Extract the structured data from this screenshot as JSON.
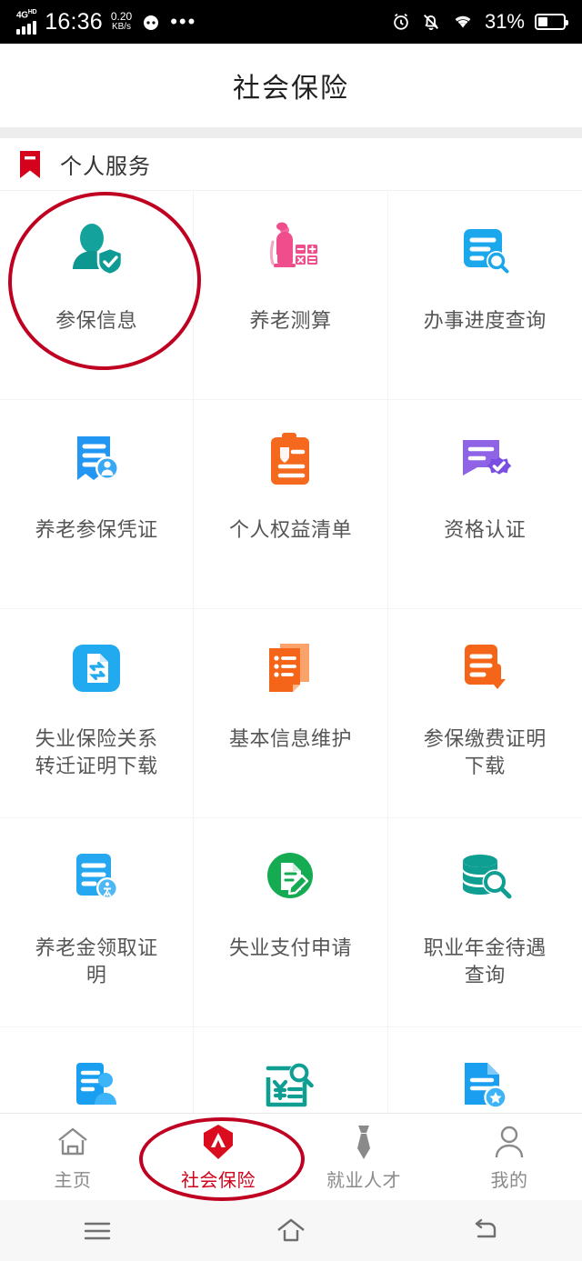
{
  "status_bar": {
    "network_label": "4G",
    "network_sup": "HD",
    "time": "16:36",
    "speed_value": "0.20",
    "speed_unit": "KB/s",
    "more_icon": "ellipsis-icon",
    "face_icon": "emoji-face-icon",
    "alarm_icon": "alarm-clock-icon",
    "mute_icon": "bell-muted-icon",
    "wifi_icon": "wifi-icon",
    "battery_percent": "31%",
    "battery_icon": "battery-icon"
  },
  "header": {
    "title": "社会保险"
  },
  "section": {
    "icon": "bookmark-icon",
    "title": "个人服务",
    "accent": "#d4021d"
  },
  "grid": {
    "items": [
      {
        "label": "参保信息",
        "icon": "person-shield-icon",
        "color": "#12a0a0"
      },
      {
        "label": "养老测算",
        "icon": "elderly-calculator-icon",
        "color": "#ef4d8b"
      },
      {
        "label": "办事进度查询",
        "icon": "document-search-icon",
        "color": "#1aa7ec"
      },
      {
        "label": "养老参保凭证",
        "icon": "certificate-person-icon",
        "color": "#2196f3"
      },
      {
        "label": "个人权益清单",
        "icon": "clipboard-list-icon",
        "color": "#f4691d"
      },
      {
        "label": "资格认证",
        "icon": "document-verified-icon",
        "color": "#8e63e6"
      },
      {
        "label": "失业保险关系转迁证明下载",
        "icon": "transfer-file-icon",
        "color": "#22aaf0"
      },
      {
        "label": "基本信息维护",
        "icon": "document-edit-list-icon",
        "color": "#f4651a"
      },
      {
        "label": "参保缴费证明下载",
        "icon": "document-download-icon",
        "color": "#f4651a"
      },
      {
        "label": "养老金领取证明",
        "icon": "document-pension-icon",
        "color": "#25a8f0"
      },
      {
        "label": "失业支付申请",
        "icon": "circle-document-pen-icon",
        "color": "#14ab52"
      },
      {
        "label": "职业年金待遇查询",
        "icon": "coins-search-icon",
        "color": "#0f9e92"
      },
      {
        "label": "",
        "icon": "id-card-person-icon",
        "color": "#1a9ff0"
      },
      {
        "label": "",
        "icon": "yuan-bill-search-icon",
        "color": "#0f9e92"
      },
      {
        "label": "",
        "icon": "document-star-icon",
        "color": "#1a9ff0"
      }
    ]
  },
  "tabbar": {
    "items": [
      {
        "label": "主页",
        "icon": "home-icon",
        "active": false
      },
      {
        "label": "社会保险",
        "icon": "social-insurance-icon",
        "active": true
      },
      {
        "label": "就业人才",
        "icon": "necktie-icon",
        "active": false
      },
      {
        "label": "我的",
        "icon": "person-outline-icon",
        "active": false
      }
    ],
    "active_color": "#d0021b"
  },
  "system_nav": {
    "items": [
      {
        "icon": "menu-icon"
      },
      {
        "icon": "home-outline-icon"
      },
      {
        "icon": "back-icon"
      }
    ]
  },
  "annotations": [
    {
      "name": "highlight-circle-canbaoxinxi",
      "color": "#c00020"
    },
    {
      "name": "highlight-circle-shehuibaoxian",
      "color": "#c00020"
    }
  ]
}
